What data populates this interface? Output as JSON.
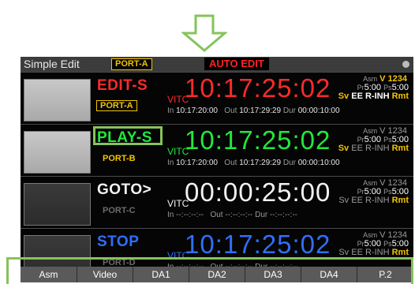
{
  "colors": {
    "highlight": "#86c35a",
    "port_yellow": "#f3c400",
    "edit_red": "#ff2a2a",
    "play_green": "#21e83a",
    "stop_blue": "#2f6fff",
    "goto_white": "#f2f2f2"
  },
  "header": {
    "title": "Simple Edit",
    "port": "PORT-A",
    "auto_edit": "AUTO EDIT"
  },
  "rows": [
    {
      "mode": "EDIT-S",
      "port": "PORT-A",
      "vitc": "VITC",
      "timecode": "10:17:25:02",
      "in_label": "In",
      "in_value": "10:17:20:00",
      "out_label": "Out",
      "out_value": "10:17:29:29",
      "dur_label": "Dur",
      "dur_value": "00:00:10:00",
      "asm_label": "Asm",
      "asm_value": "V 1234",
      "pr_label": "Pr",
      "pr_value": "5:00",
      "ps_label": "Ps",
      "ps_value": "5:00",
      "sv": "Sv",
      "ee": "EE",
      "rinh": "R-INH",
      "rmt": "Rmt"
    },
    {
      "mode": "PLAY-S",
      "port": "PORT-B",
      "vitc": "VITC",
      "timecode": "10:17:25:02",
      "in_label": "In",
      "in_value": "10:17:20:00",
      "out_label": "Out",
      "out_value": "10:17:29:29",
      "dur_label": "Dur",
      "dur_value": "00:00:10:00",
      "asm_label": "Asm",
      "asm_value": "V 1234",
      "pr_label": "Pr",
      "pr_value": "5:00",
      "ps_label": "Ps",
      "ps_value": "5:00",
      "sv": "Sv",
      "ee": "EE",
      "rinh": "R-INH",
      "rmt": "Rmt"
    },
    {
      "mode": "GOTO>",
      "port": "PORT-C",
      "vitc": "VITC",
      "timecode": "00:00:25:00",
      "in_label": "In",
      "in_value": "--:--:--:--",
      "out_label": "Out",
      "out_value": "--:--:--:--",
      "dur_label": "Dur",
      "dur_value": "--:--:--:--",
      "asm_label": "Asm",
      "asm_value": "V 1234",
      "pr_label": "Pr",
      "pr_value": "5:00",
      "ps_label": "Ps",
      "ps_value": "5:00",
      "sv": "Sv",
      "ee": "EE",
      "rinh": "R-INH",
      "rmt": "Rmt"
    },
    {
      "mode": "STOP",
      "port": "PORT-D",
      "vitc": "VITC",
      "timecode": "10:17:25:02",
      "in_label": "In",
      "in_value": "--:--:--:--",
      "out_label": "Out",
      "out_value": "--:--:--:--",
      "dur_label": "Dur",
      "dur_value": "--:--:--:--",
      "asm_label": "Asm",
      "asm_value": "V 1234",
      "pr_label": "Pr",
      "pr_value": "5:00",
      "ps_label": "Ps",
      "ps_value": "5:00",
      "sv": "Sv",
      "ee": "EE",
      "rinh": "R-INH",
      "rmt": "Rmt"
    }
  ],
  "softkeys": [
    "Asm",
    "Video",
    "DA1",
    "DA2",
    "DA3",
    "DA4",
    "P.2"
  ]
}
